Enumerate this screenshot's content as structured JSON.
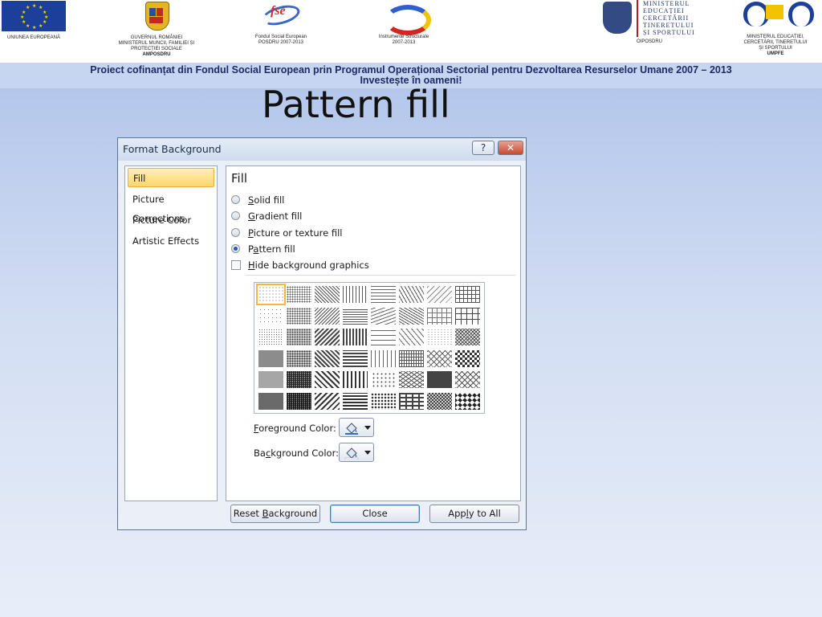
{
  "header": {
    "logos": [
      {
        "name": "eu-flag",
        "caption": [
          "UNIUNEA EUROPEANĂ"
        ]
      },
      {
        "name": "romania-government-crest",
        "caption": [
          "GUVERNUL ROMÂNIEI",
          "MINISTERUL MUNCII, FAMILIEI ȘI",
          "PROTECȚIEI SOCIALE",
          "AMPOSDRU"
        ]
      },
      {
        "name": "fse-logo",
        "logo_text": "fse",
        "caption": [
          "Fondul Social European",
          "POSDRU 2007-2013"
        ]
      },
      {
        "name": "structural-instruments-logo",
        "caption": [
          "Instrumente Structurale",
          "2007-2013"
        ]
      },
      {
        "name": "ministry-crest",
        "logo_text": [
          "MINISTERUL",
          "EDUCAȚIEI",
          "CERCETĂRII",
          "TINERETULUI",
          "ȘI SPORTULUI"
        ],
        "caption": [
          "OIPOSDRU"
        ]
      },
      {
        "name": "umpfe-logo",
        "caption": [
          "MINISTERUL EDUCAȚIEI,",
          "CERCETĂRII, TINERETULUI",
          "ȘI SPORTULUI",
          "UMPFE"
        ]
      }
    ],
    "project_line1": "Proiect cofinanțat din Fondul Social European prin Programul Operațional Sectorial pentru Dezvoltarea Resurselor Umane 2007 – 2013",
    "project_line2": "Investește în oameni!"
  },
  "slide": {
    "title": "Pattern fill"
  },
  "dialog": {
    "title": "Format Background",
    "help_label": "?",
    "close_label": "✕",
    "nav": [
      {
        "label": "Fill",
        "selected": true
      },
      {
        "label": "Picture Corrections",
        "selected": false
      },
      {
        "label": "Picture Color",
        "selected": false
      },
      {
        "label": "Artistic Effects",
        "selected": false
      }
    ],
    "fill_heading": "Fill",
    "options": [
      {
        "accel": "S",
        "rest": "olid fill",
        "selected": false
      },
      {
        "accel": "G",
        "rest": "radient fill",
        "selected": false
      },
      {
        "accel": "P",
        "rest": "icture or texture fill",
        "selected": false
      },
      {
        "pre": "P",
        "accel": "a",
        "rest": "ttern fill",
        "selected": true
      }
    ],
    "hide_background": {
      "accel": "H",
      "rest": "ide background graphics",
      "checked": false
    },
    "pattern_grid": {
      "rows": 6,
      "cols": 8,
      "selected_index": 0
    },
    "foreground_color": {
      "accel": "F",
      "rest": "oreground Color:"
    },
    "background_color": {
      "pre": "Ba",
      "accel": "c",
      "rest": "kground Color:"
    },
    "buttons": {
      "reset": {
        "pre": "Reset ",
        "accel": "B",
        "rest": "ackground"
      },
      "close": "Close",
      "apply": {
        "pre": "App",
        "accel": "l",
        "rest": "y to All"
      }
    }
  },
  "colors": {
    "accent_selected": "#fdd66a",
    "radio_dot": "#1f59b8",
    "close_button": "#c64a32"
  }
}
